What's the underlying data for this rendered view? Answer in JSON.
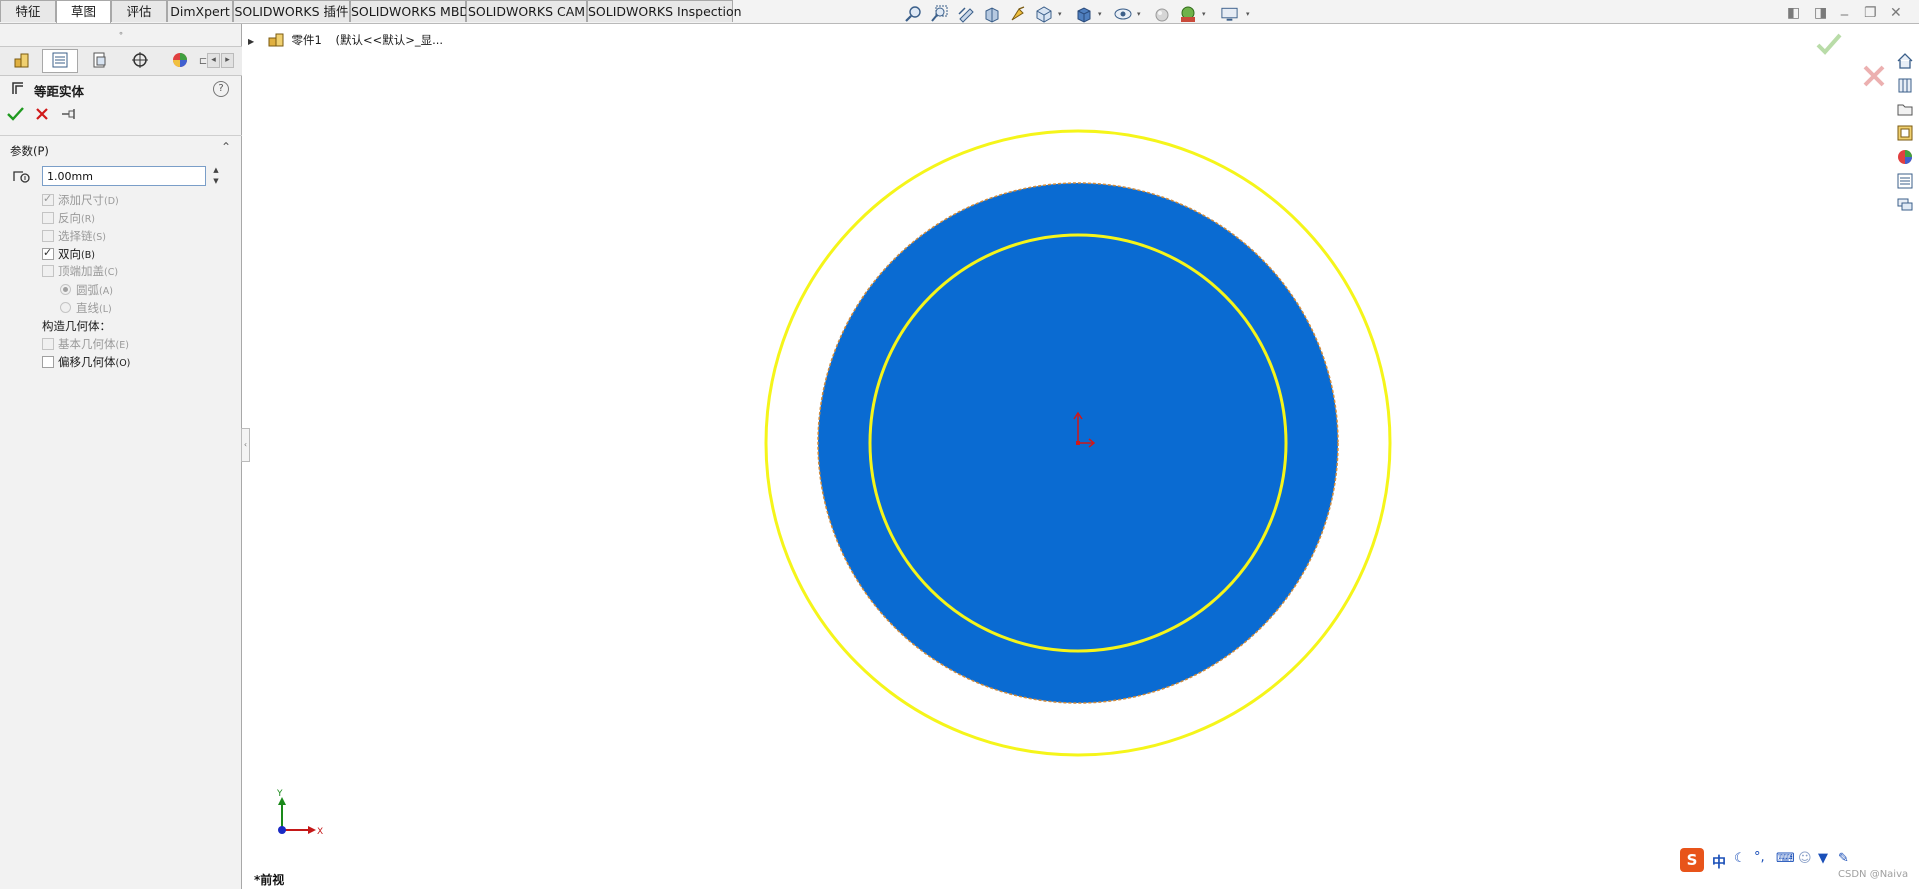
{
  "ribbon": {
    "tabs": [
      {
        "label": "特征"
      },
      {
        "label": "草图",
        "active": true
      },
      {
        "label": "评估"
      },
      {
        "label": "DimXpert"
      },
      {
        "label": "SOLIDWORKS 插件"
      },
      {
        "label": "SOLIDWORKS MBD"
      },
      {
        "label": "SOLIDWORKS CAM"
      },
      {
        "label": "SOLIDWORKS Inspection"
      }
    ]
  },
  "heads_up_toolbar": {
    "icons": [
      "zoom-to-fit-icon",
      "zoom-to-area-icon",
      "previous-view-icon",
      "section-view-icon",
      "dynamic-annotation-icon",
      "view-orientation-icon",
      "display-style-icon",
      "hide-show-items-icon",
      "edit-appearance-icon",
      "apply-scene-icon",
      "view-settings-icon"
    ]
  },
  "property_manager": {
    "title": "等距实体",
    "help_icon": "help-icon",
    "params_section": "参数(P)",
    "distance_value": "1.00mm",
    "options": {
      "add_dims": {
        "label": "添加尺寸",
        "hotkey": "(D)",
        "checked": true,
        "disabled": true
      },
      "reverse": {
        "label": "反向",
        "hotkey": "(R)",
        "checked": false,
        "disabled": true
      },
      "select_chain": {
        "label": "选择链",
        "hotkey": "(S)",
        "checked": false,
        "disabled": true
      },
      "bidirectional": {
        "label": "双向",
        "hotkey": "(B)",
        "checked": true,
        "disabled": false
      },
      "cap_ends": {
        "label": "顶端加盖",
        "hotkey": "(C)",
        "checked": false,
        "disabled": true
      },
      "arcs": {
        "label": "圆弧",
        "hotkey": "(A)",
        "selected": true,
        "disabled": true
      },
      "lines": {
        "label": "直线",
        "hotkey": "(L)",
        "selected": false,
        "disabled": true
      }
    },
    "construction_heading": "构造几何体：",
    "construction": {
      "base_geometry": {
        "label": "基本几何体",
        "hotkey": "(E)",
        "checked": false,
        "disabled": true
      },
      "offset_geometry": {
        "label": "偏移几何体",
        "hotkey": "(O)",
        "checked": false,
        "disabled": false
      }
    }
  },
  "feature_tree": {
    "item": "零件1",
    "config": "(默认<<默认>_显..."
  },
  "graphics": {
    "view_name": "*前视",
    "axis_x": "X",
    "axis_y": "Y",
    "colors": {
      "fill": "#0a6bd2",
      "offset_circle": "#f5f51a",
      "edge": "#d08a3a",
      "origin": "#d01818",
      "background": "#ffffff"
    }
  },
  "confirm_corner": {
    "ok_icon": "checkmark-icon",
    "cancel_icon": "close-icon"
  },
  "ime_bar": {
    "lang": "中"
  },
  "watermark": "CSDN @Naiva"
}
